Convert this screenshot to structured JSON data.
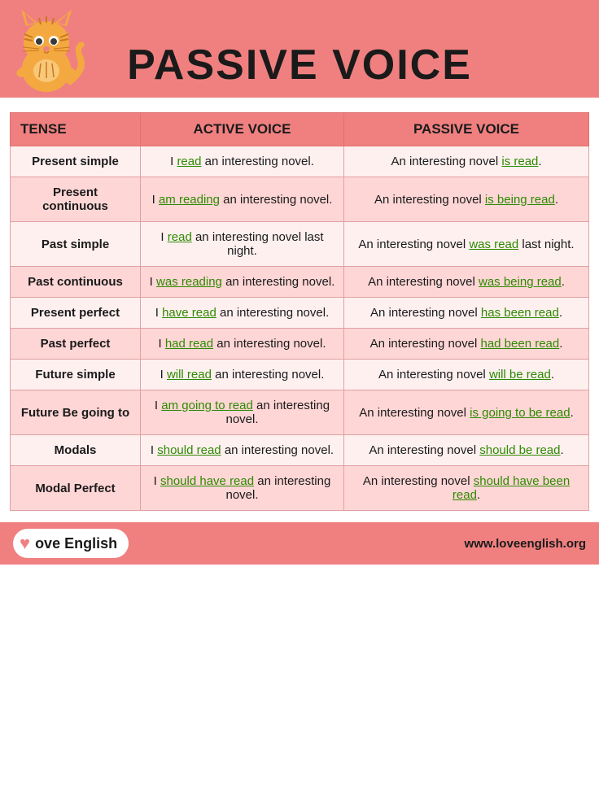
{
  "header": {
    "title": "PASSIVE VOICE"
  },
  "footer": {
    "logo_text": "ove English",
    "url": "www.loveenglish.org"
  },
  "table": {
    "headers": [
      "TENSE",
      "ACTIVE VOICE",
      "PASSIVE VOICE"
    ],
    "rows": [
      {
        "tense": "Present simple",
        "active_prefix": "I ",
        "active_link": "read",
        "active_suffix": " an interesting novel.",
        "passive_prefix": "An interesting novel ",
        "passive_link": "is read",
        "passive_suffix": "."
      },
      {
        "tense": "Present continuous",
        "active_prefix": "I ",
        "active_link": "am reading",
        "active_suffix": " an interesting novel.",
        "passive_prefix": "An interesting novel ",
        "passive_link": "is being read",
        "passive_suffix": "."
      },
      {
        "tense": "Past simple",
        "active_prefix": "I ",
        "active_link": "read",
        "active_suffix": " an interesting novel last night.",
        "passive_prefix": "An interesting novel ",
        "passive_link": "was read",
        "passive_suffix": " last night."
      },
      {
        "tense": "Past continuous",
        "active_prefix": "I ",
        "active_link": "was reading",
        "active_suffix": " an interesting novel.",
        "passive_prefix": "An interesting novel ",
        "passive_link": "was being read",
        "passive_suffix": "."
      },
      {
        "tense": "Present perfect",
        "active_prefix": "I ",
        "active_link": "have read",
        "active_suffix": " an interesting novel.",
        "passive_prefix": "An interesting novel ",
        "passive_link": "has been read",
        "passive_suffix": "."
      },
      {
        "tense": "Past perfect",
        "active_prefix": "I ",
        "active_link": "had read",
        "active_suffix": " an interesting novel.",
        "passive_prefix": "An interesting novel ",
        "passive_link": "had been read",
        "passive_suffix": "."
      },
      {
        "tense": "Future simple",
        "active_prefix": "I ",
        "active_link": "will read",
        "active_suffix": " an interesting novel.",
        "passive_prefix": "An interesting novel ",
        "passive_link": "will be read",
        "passive_suffix": "."
      },
      {
        "tense": "Future Be going to",
        "active_prefix": "I ",
        "active_link": "am going to read",
        "active_suffix": " an interesting novel.",
        "passive_prefix": "An interesting novel ",
        "passive_link": "is going to be read",
        "passive_suffix": "."
      },
      {
        "tense": "Modals",
        "active_prefix": "I ",
        "active_link": "should read",
        "active_suffix": " an interesting novel.",
        "passive_prefix": "An interesting novel ",
        "passive_link": "should be read",
        "passive_suffix": "."
      },
      {
        "tense": "Modal Perfect",
        "active_prefix": "I ",
        "active_link": "should have read",
        "active_suffix": " an interesting novel.",
        "passive_prefix": "An interesting novel ",
        "passive_link": "should have been read",
        "passive_suffix": "."
      }
    ]
  }
}
